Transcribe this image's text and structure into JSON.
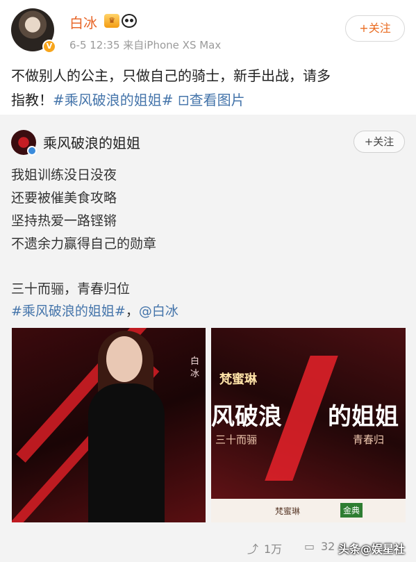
{
  "post": {
    "username": "白冰",
    "vip_badge": "V",
    "meta": "6-5 12:35  来自iPhone XS Max",
    "follow_label": "+关注",
    "text_line1": "不做别人的公主，只做自己的骑士，新手出战，请多",
    "text_line2_prefix": "指教！",
    "hashtag": "#乘风破浪的姐姐#",
    "view_images": "查看图片"
  },
  "repost": {
    "name": "乘风破浪的姐姐",
    "follow_label": "+关注",
    "lines": [
      "我姐训练没日没夜",
      "还要被催美食攻略",
      "坚持热爱一路铿锵",
      "不遗余力赢得自己的勋章",
      "三十而骊，青春归位"
    ],
    "hashtag": "#乘风破浪的姐姐#",
    "separator": "，",
    "mention": "@白冰",
    "image_left": {
      "side_name": "白冰"
    },
    "image_right": {
      "sponsor": "梵蜜琳",
      "title": "风破浪",
      "title_tail": "的姐姐",
      "sub_left": "三十而骊",
      "sub_right": "青春归",
      "bottom_left": "梵蜜琳",
      "bottom_right": "金典"
    }
  },
  "footer": {
    "repost_count": "1万",
    "comment_count": "32",
    "watermark": "头条@娱星社"
  },
  "colors": {
    "accent": "#ea6b20",
    "link": "#4474aa",
    "brand_red": "#d81f26"
  }
}
